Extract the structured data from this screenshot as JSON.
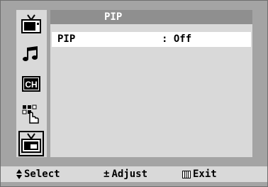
{
  "menu": {
    "title": "PIP",
    "items": [
      {
        "label": "PIP",
        "separator": ":",
        "value": "Off"
      }
    ]
  },
  "sidebar": {
    "icons": [
      "picture-icon",
      "sound-icon",
      "channel-icon",
      "function-icon",
      "pip-icon"
    ],
    "channel_text": "CH",
    "active": "pip-icon"
  },
  "footer": {
    "select_symbol": "⬍",
    "select_label": "Select",
    "adjust_symbol": "±",
    "adjust_label": "Adjust",
    "exit_symbol": "▥",
    "exit_label": "Exit"
  }
}
